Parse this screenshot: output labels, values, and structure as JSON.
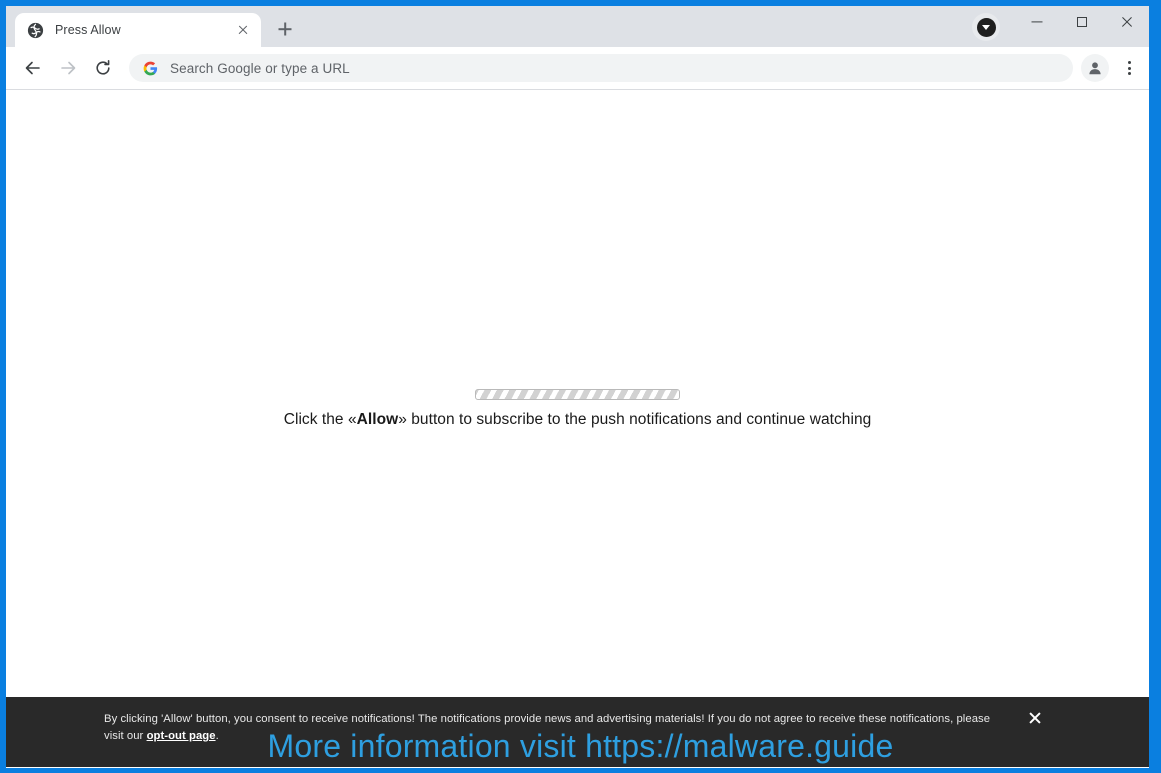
{
  "window": {
    "frame_color": "#0a7fe0",
    "controls": {
      "minimize_label": "Minimize",
      "maximize_label": "Maximize",
      "close_label": "Close"
    },
    "download_indicator": "download-icon"
  },
  "tabstrip": {
    "tabs": [
      {
        "title": "Press Allow",
        "favicon": "globe-icon",
        "close_label": "Close tab"
      }
    ],
    "new_tab_label": "New tab"
  },
  "toolbar": {
    "back_label": "Back",
    "forward_label": "Forward",
    "reload_label": "Reload",
    "omnibox": {
      "value": "",
      "placeholder": "Search Google or type a URL",
      "leading_icon": "google-g-icon"
    },
    "profile_label": "Profile",
    "menu_label": "Customize and control Google Chrome"
  },
  "page": {
    "loader": {
      "progress_style": "striped-indeterminate",
      "text_before": "Click the «",
      "text_bold": "Allow",
      "text_after": "» button to subscribe to the push notifications and continue watching",
      "full_text": "Click the «Allow» button to subscribe to the push notifications and continue watching"
    },
    "consent_banner": {
      "text_part1": "By clicking 'Allow' button, you consent to receive notifications! The notifications provide news and advertising materials! If you do not agree to receive these notifications, please visit our ",
      "link_text": "opt-out page",
      "text_part2": ".",
      "close_label": "Close banner",
      "background_color": "#292929"
    }
  },
  "watermark": {
    "text": "More information visit https://malware.guide",
    "color": "#2e9fe0"
  }
}
